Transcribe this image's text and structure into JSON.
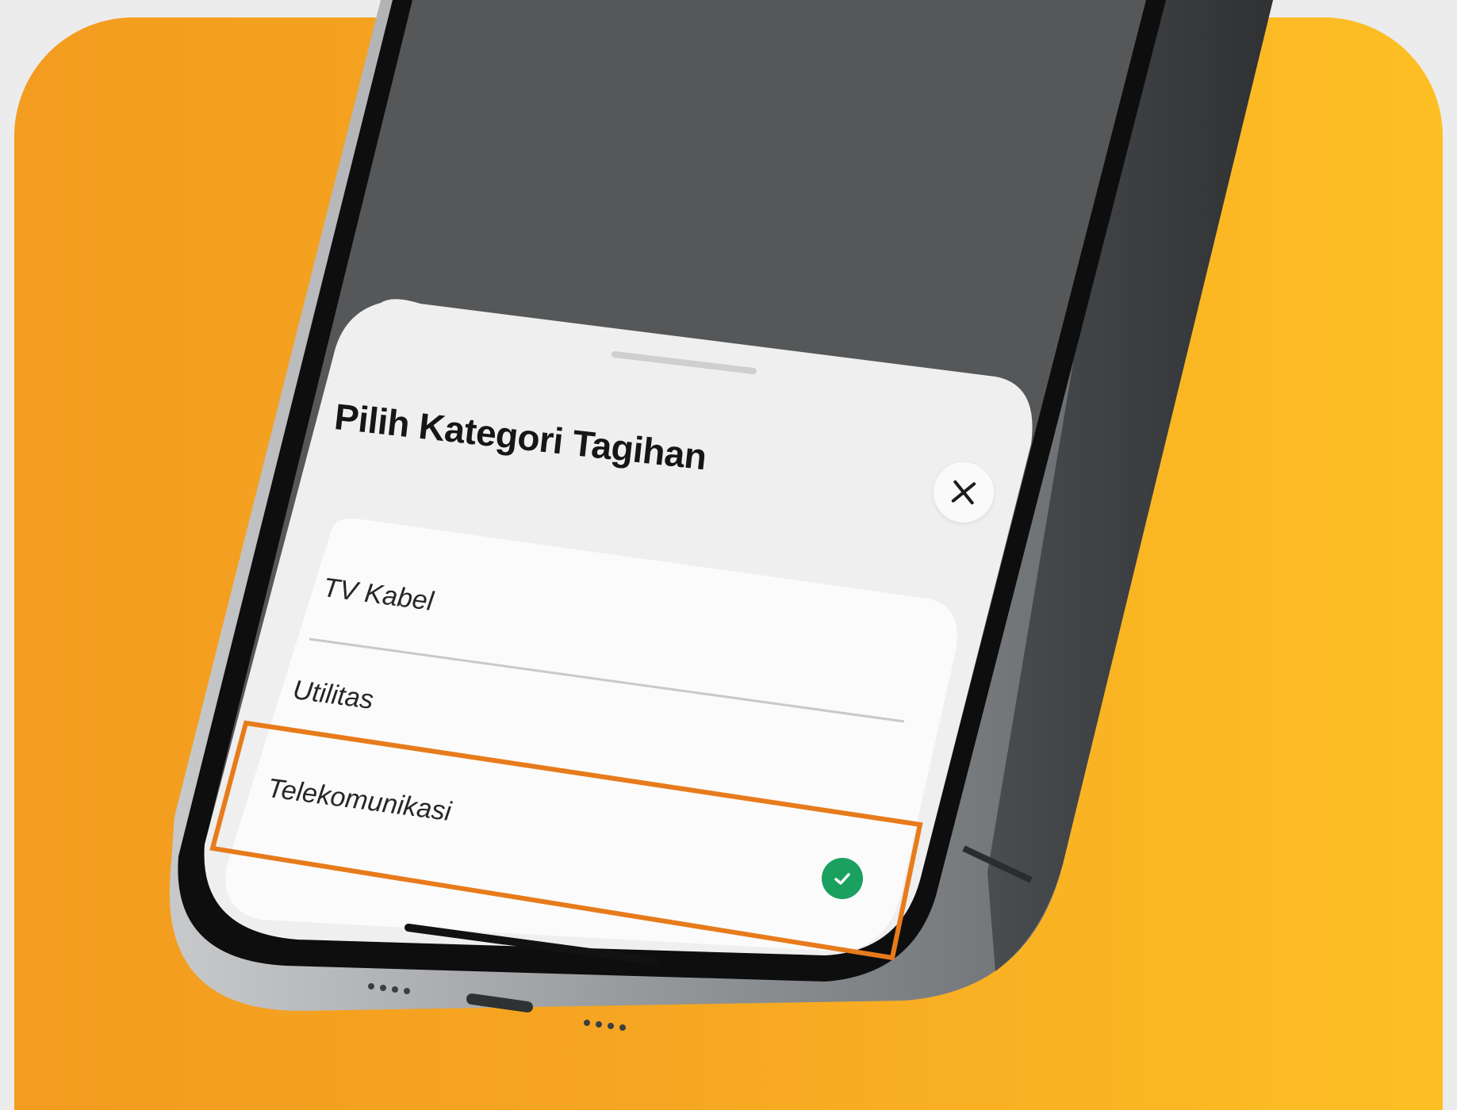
{
  "sheet": {
    "title": "Pilih Kategori Tagihan",
    "close_icon": "close-icon",
    "items": [
      {
        "label": "TV Kabel",
        "selected": false
      },
      {
        "label": "Utilitas",
        "selected": false
      },
      {
        "label": "Telekomunikasi",
        "selected": true
      }
    ],
    "selected_icon": "check-circle-icon"
  },
  "colors": {
    "background_left": "#f39c1f",
    "background_right": "#fdbf24",
    "phone_screen": "#555759",
    "sheet_bg": "#efefef",
    "list_bg": "#fbfbfb",
    "highlight": "#e77b1b",
    "check": "#1aa15f"
  }
}
